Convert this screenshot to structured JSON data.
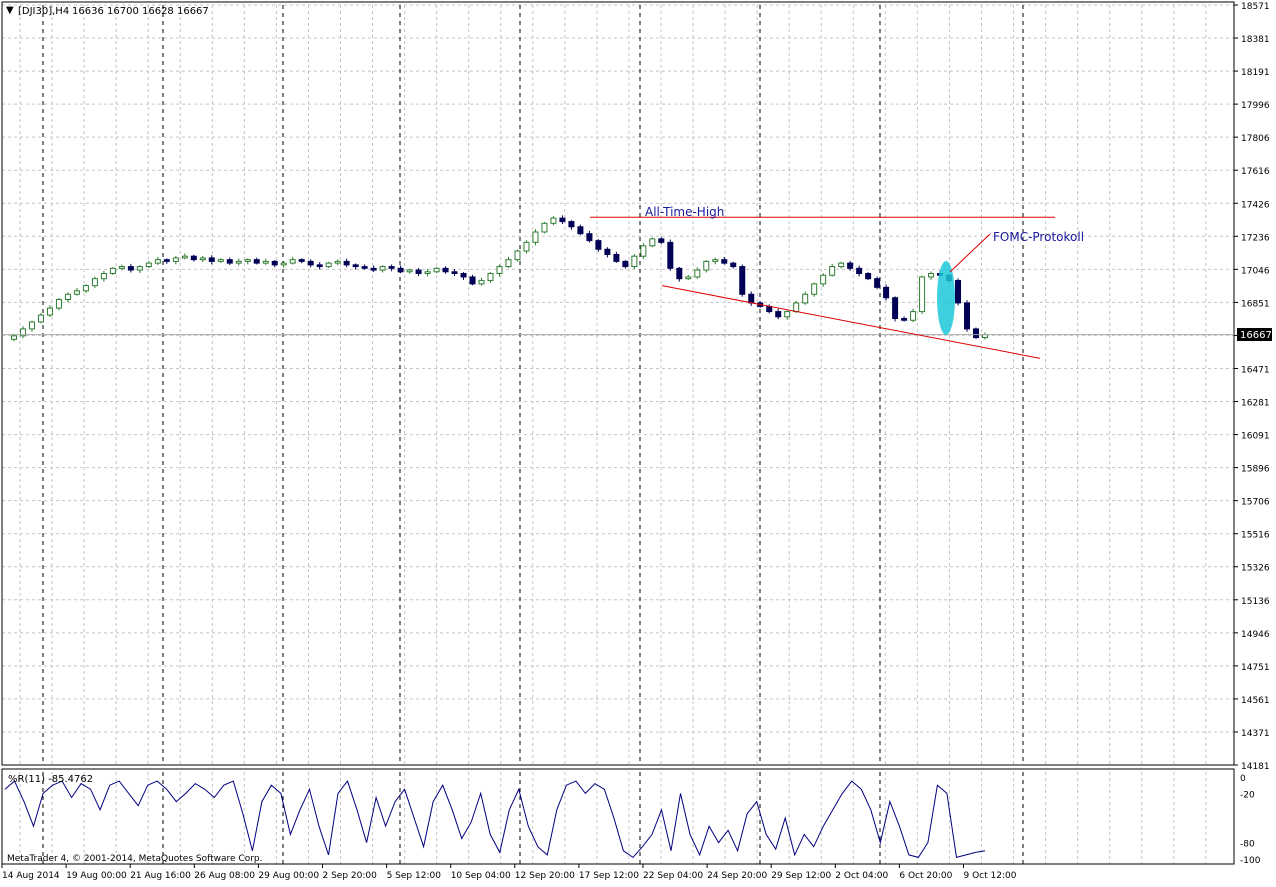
{
  "header": {
    "symbol": "[DJI30],H4",
    "ohlc": "16636 16700 16628 16667"
  },
  "footer": {
    "copyright": "MetaTrader 4, © 2001-2014, MetaQuotes Software Corp."
  },
  "colors": {
    "background": "#ffffff",
    "bull": "#2e7d32",
    "bear": "#000055",
    "trendline": "#dd0000",
    "annotation_text": "#1a1aa0",
    "oscillator": "#000080",
    "highlight": "#1cc8d8",
    "price_tag_bg": "#000000"
  },
  "chart_data": [
    {
      "type": "candlestick",
      "symbol": "DJI30",
      "timeframe": "H4",
      "ylim": [
        14181,
        18571
      ],
      "y_tick_labels": [
        "18571",
        "18381",
        "18191",
        "17996",
        "17806",
        "17616",
        "17426",
        "17236",
        "17046",
        "16851",
        "16661",
        "16471",
        "16281",
        "16091",
        "15896",
        "15706",
        "15516",
        "15326",
        "15136",
        "14946",
        "14751",
        "14561",
        "14371",
        "14181"
      ],
      "x_tick_labels": [
        "14 Aug 2014",
        "19 Aug 00:00",
        "21 Aug 16:00",
        "26 Aug 08:00",
        "29 Aug 00:00",
        "2 Sep 20:00",
        "5 Sep 12:00",
        "10 Sep 04:00",
        "12 Sep 20:00",
        "17 Sep 12:00",
        "22 Sep 04:00",
        "24 Sep 20:00",
        "29 Sep 12:00",
        "2 Oct 04:00",
        "6 Oct 20:00",
        "9 Oct 12:00"
      ],
      "current_price": "16667",
      "price_series": [
        16640,
        16660,
        16700,
        16740,
        16780,
        16820,
        16870,
        16900,
        16920,
        16950,
        16990,
        17020,
        17050,
        17060,
        17040,
        17060,
        17080,
        17100,
        17090,
        17110,
        17120,
        17100,
        17110,
        17090,
        17100,
        17080,
        17090,
        17100,
        17080,
        17090,
        17070,
        17080,
        17100,
        17090,
        17070,
        17060,
        17080,
        17090,
        17070,
        17060,
        17050,
        17040,
        17060,
        17050,
        17030,
        17040,
        17020,
        17030,
        17050,
        17030,
        17020,
        17000,
        16960,
        16980,
        17020,
        17060,
        17100,
        17150,
        17200,
        17260,
        17310,
        17340,
        17320,
        17290,
        17250,
        17210,
        17160,
        17130,
        17090,
        17060,
        17120,
        17180,
        17220,
        17200,
        17050,
        16990,
        17000,
        17040,
        17090,
        17100,
        17080,
        17060,
        16900,
        16850,
        16830,
        16800,
        16770,
        16800,
        16850,
        16900,
        16960,
        17010,
        17060,
        17080,
        17050,
        17020,
        16990,
        16940,
        16880,
        16760,
        16750,
        16800,
        17000,
        17020,
        17010,
        16980,
        16850,
        16700,
        16650,
        16667
      ],
      "annotations": [
        {
          "text": "All-Time-High",
          "kind": "horizontal-line",
          "price": 17345
        },
        {
          "text": "FOMC-Protokoll",
          "kind": "label-with-pointer"
        }
      ],
      "trendlines": [
        {
          "kind": "descending-support",
          "from_price": 16950,
          "to_price": 16530
        }
      ]
    },
    {
      "type": "line",
      "indicator": "WPR(11)",
      "label": "%R(11) -85.4762",
      "ylim": [
        -100,
        0
      ],
      "y_tick_labels": [
        "0",
        "-20",
        "-80",
        "-100"
      ],
      "values": [
        -15,
        -5,
        -30,
        -60,
        -20,
        -10,
        -5,
        -25,
        -8,
        -15,
        -40,
        -10,
        -5,
        -20,
        -35,
        -10,
        -5,
        -15,
        -30,
        -20,
        -8,
        -15,
        -25,
        -10,
        -5,
        -45,
        -90,
        -30,
        -10,
        -20,
        -70,
        -40,
        -15,
        -60,
        -95,
        -20,
        -5,
        -40,
        -80,
        -25,
        -60,
        -30,
        -15,
        -50,
        -85,
        -30,
        -10,
        -40,
        -75,
        -55,
        -20,
        -70,
        -92,
        -40,
        -15,
        -60,
        -85,
        -95,
        -40,
        -10,
        -5,
        -20,
        -8,
        -15,
        -50,
        -90,
        -98,
        -85,
        -70,
        -40,
        -90,
        -20,
        -70,
        -95,
        -60,
        -80,
        -65,
        -90,
        -45,
        -30,
        -70,
        -88,
        -50,
        -95,
        -70,
        -85,
        -60,
        -40,
        -20,
        -5,
        -15,
        -40,
        -80,
        -30,
        -60,
        -95,
        -98,
        -80,
        -10,
        -20,
        -98,
        -95,
        -92,
        -90
      ]
    }
  ]
}
